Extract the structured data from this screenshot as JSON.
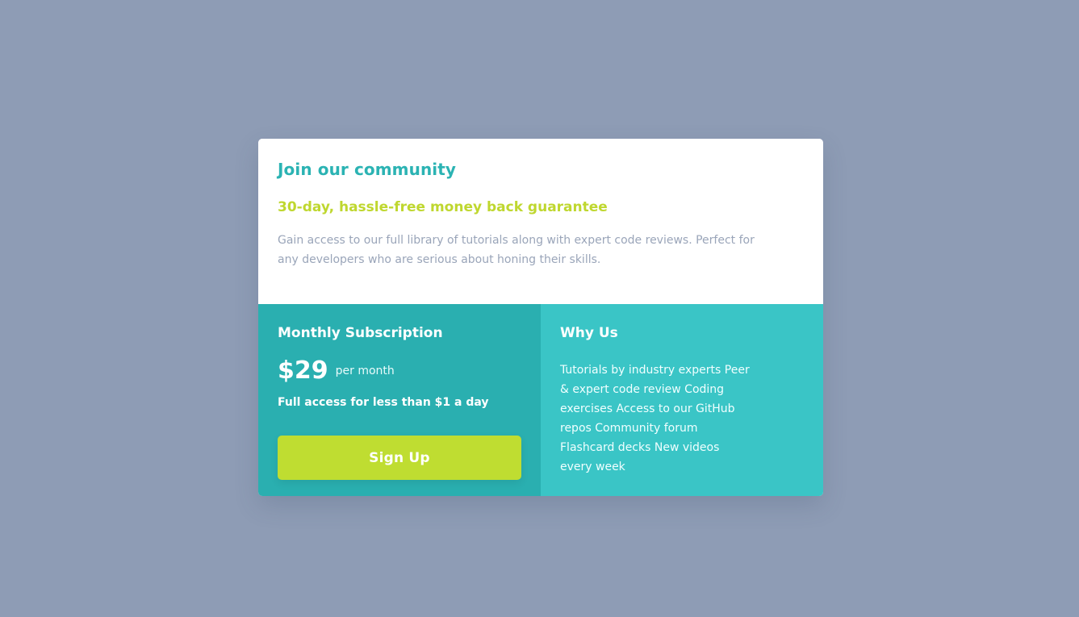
{
  "card": {
    "title": "Join our community",
    "guarantee": "30-day, hassle-free money back guarantee",
    "description": "Gain access to our full library of tutorials along with expert code reviews. Perfect for any developers who are serious about honing their skills."
  },
  "subscription": {
    "heading": "Monthly Subscription",
    "price": "$29",
    "price_period": "per month",
    "tagline": "Full access for less than $1 a day",
    "button_label": "Sign Up"
  },
  "why_us": {
    "heading": "Why Us",
    "text": "Tutorials by industry experts Peer & expert code review Coding exercises Access to our GitHub repos Community forum Flashcard decks New videos every week"
  },
  "colors": {
    "background": "#8e9cb5",
    "accent_teal": "#2bb3b3",
    "accent_lime": "#bfd72f",
    "panel_dark": "#2aafb0",
    "panel_light": "#3ac5c6"
  }
}
